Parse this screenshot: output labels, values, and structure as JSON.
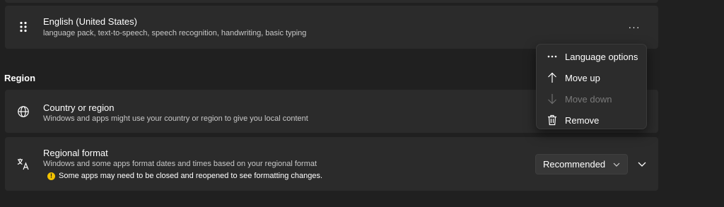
{
  "language_card": {
    "title": "English (United States)",
    "description": "language pack, text-to-speech, speech recognition, handwriting, basic typing",
    "more_label": "···"
  },
  "region_section": {
    "title": "Region"
  },
  "country_card": {
    "title": "Country or region",
    "description": "Windows and apps might use your country or region to give you local content"
  },
  "format_card": {
    "title": "Regional format",
    "description": "Windows and some apps format dates and times based on your regional format",
    "warning": "Some apps may need to be closed and reopened to see formatting changes.",
    "warning_glyph": "!",
    "dropdown_value": "Recommended"
  },
  "context_menu": {
    "items": [
      {
        "label": "Language options",
        "icon": "more-icon",
        "disabled": false
      },
      {
        "label": "Move up",
        "icon": "arrow-up-icon",
        "disabled": false
      },
      {
        "label": "Move down",
        "icon": "arrow-down-icon",
        "disabled": true
      },
      {
        "label": "Remove",
        "icon": "trash-icon",
        "disabled": false
      }
    ]
  },
  "colors": {
    "background": "#202020",
    "card": "#2b2b2b",
    "warning": "#f2c200",
    "disabled_text": "#7a7a7a"
  }
}
